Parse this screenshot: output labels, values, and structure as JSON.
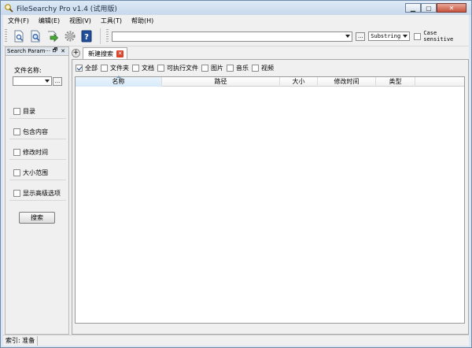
{
  "window": {
    "title": "FileSearchy Pro v1.4 (试用版)"
  },
  "menu": [
    "文件(F)",
    "编辑(E)",
    "视图(V)",
    "工具(T)",
    "帮助(H)"
  ],
  "toolbar": {
    "search_text": "",
    "dots_label": "...",
    "match_mode": "Substring",
    "case_sensitive_label": "Case sensitive",
    "case_sensitive_checked": false,
    "icons": [
      "new-search-icon",
      "search-window-icon",
      "go-arrow-icon",
      "settings-gear-icon",
      "help-icon"
    ]
  },
  "left_panel": {
    "title": "Search Param···",
    "pin": "🗗",
    "close": "✕",
    "filename_label": "文件名称:",
    "filename_value": "",
    "dots_label": "...",
    "filters": [
      "目录",
      "包含内容",
      "修改时间",
      "大小范围",
      "显示高级选项"
    ],
    "search_button": "搜索"
  },
  "tabs": {
    "new_tab_glyph": "+",
    "items": [
      {
        "label": "新建搜索",
        "close": "✕"
      }
    ]
  },
  "type_filters": [
    {
      "label": "全部",
      "checked": true
    },
    {
      "label": "文件夹",
      "checked": false
    },
    {
      "label": "文档",
      "checked": false
    },
    {
      "label": "可执行文件",
      "checked": false
    },
    {
      "label": "图片",
      "checked": false
    },
    {
      "label": "音乐",
      "checked": false
    },
    {
      "label": "视频",
      "checked": false
    }
  ],
  "columns": [
    "名称",
    "路径",
    "大小",
    "修改时间",
    "类型"
  ],
  "status": {
    "index": "索引: 准备"
  }
}
